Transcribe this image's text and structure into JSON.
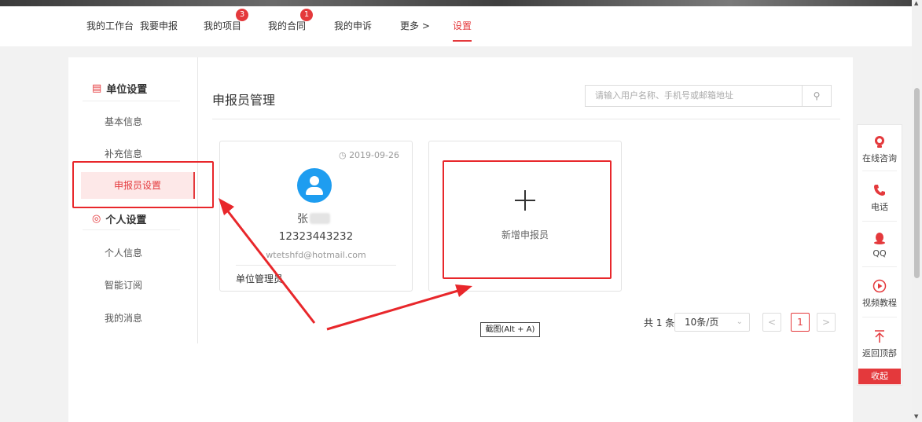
{
  "nav": {
    "items": [
      {
        "label": "我的工作台"
      },
      {
        "label": "我要申报"
      },
      {
        "label": "我的项目",
        "badge": "3"
      },
      {
        "label": "我的合同",
        "badge": "1"
      },
      {
        "label": "我的申诉"
      },
      {
        "label": "更多 >"
      },
      {
        "label": "设置",
        "active": true
      }
    ]
  },
  "sidebar": {
    "unit_section": "单位设置",
    "unit_items": [
      "基本信息",
      "补充信息",
      "申报员设置"
    ],
    "personal_section": "个人设置",
    "personal_items": [
      "个人信息",
      "智能订阅",
      "我的消息"
    ],
    "active_item": "申报员设置"
  },
  "content": {
    "title": "申报员管理",
    "search_placeholder": "请输入用户名称、手机号或邮箱地址"
  },
  "card": {
    "date": "2019-09-26",
    "name": "张",
    "phone": "12323443232",
    "email": "wtetshfd@hotmail.com",
    "role": "单位管理员"
  },
  "add_card": {
    "label": "新增申报员"
  },
  "pager": {
    "total": "共 1 条",
    "page_size": "10条/页",
    "current_page": "1",
    "prev": "<",
    "next": ">"
  },
  "tooltip": "截图(Alt + A)",
  "floatbar": {
    "items": [
      "在线咨询",
      "电话",
      "QQ",
      "视频教程",
      "返回顶部"
    ],
    "collapse": "收起"
  },
  "colors": {
    "accent": "#e4393c",
    "avatar": "#1e9df0",
    "annotation": "#e8272b"
  }
}
